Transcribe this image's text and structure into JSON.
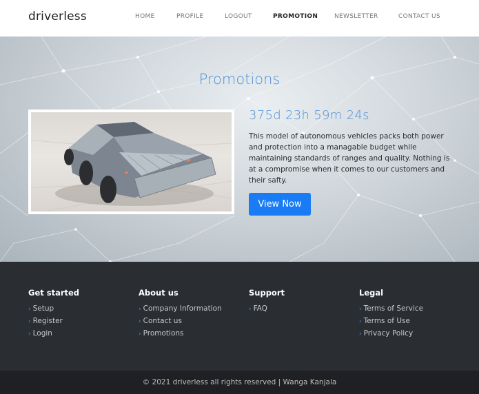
{
  "brand": "driverless",
  "nav": {
    "items": [
      "HOME",
      "PROFILE",
      "LOGOUT",
      "PROMOTION",
      "NEWSLETTER",
      "CONTACT US"
    ],
    "active": "PROMOTION"
  },
  "hero": {
    "title": "Promotions",
    "countdown": "375d 23h 59m 24s",
    "description": "This model of autonomous vehicles packs both power and protection into a managable budget while maintaining standards of ranges and quality. Nothing is at a compromise when it comes to our customers and their safty.",
    "button_label": "View Now"
  },
  "footer": {
    "columns": [
      {
        "heading": "Get started",
        "links": [
          "Setup",
          "Register",
          "Login"
        ]
      },
      {
        "heading": "About us",
        "links": [
          "Company Information",
          "Contact us",
          "Promotions"
        ]
      },
      {
        "heading": "Support",
        "links": [
          "FAQ"
        ]
      },
      {
        "heading": "Legal",
        "links": [
          "Terms of Service",
          "Terms of Use",
          "Privacy Policy"
        ]
      }
    ],
    "copyright": "© 2021 driverless all rights reserved | Wanga Kanjala"
  },
  "colors": {
    "accent": "#4a90d9",
    "button": "#1a7cf5",
    "footer_bg": "#2a2d32",
    "bottom_bar_bg": "#1e2024"
  }
}
